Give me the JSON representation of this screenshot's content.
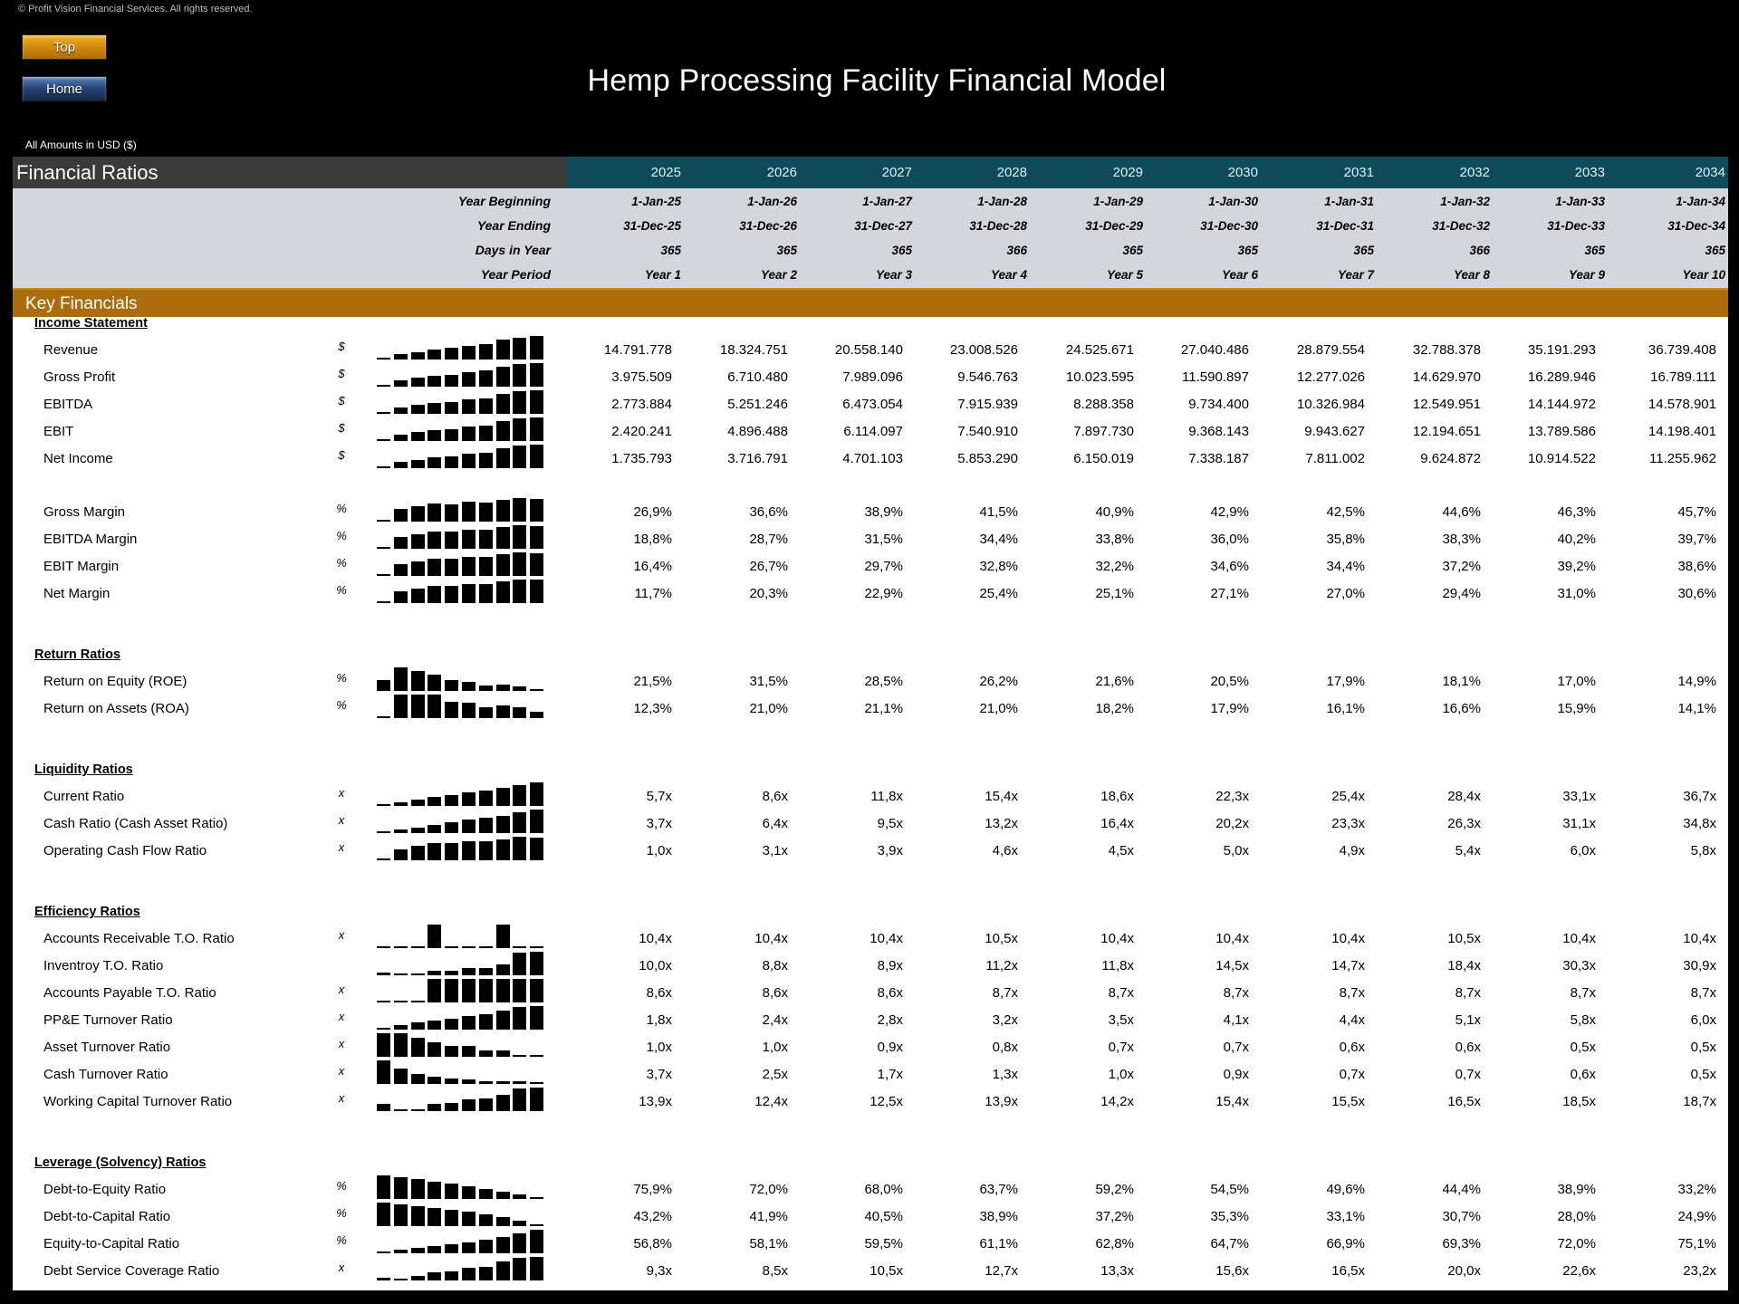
{
  "copyright": "© Profit Vision Financial Services. All rights reserved.",
  "nav": {
    "top_label": "Top",
    "home_label": "Home"
  },
  "title": "Hemp Processing Facility Financial Model",
  "currency_note": "All Amounts in  USD ($)",
  "sheet": {
    "title": "Financial Ratios",
    "years": [
      "2025",
      "2026",
      "2027",
      "2028",
      "2029",
      "2030",
      "2031",
      "2032",
      "2033",
      "2034"
    ],
    "date_rows": [
      {
        "label": "Year Beginning",
        "values": [
          "1-Jan-25",
          "1-Jan-26",
          "1-Jan-27",
          "1-Jan-28",
          "1-Jan-29",
          "1-Jan-30",
          "1-Jan-31",
          "1-Jan-32",
          "1-Jan-33",
          "1-Jan-34"
        ]
      },
      {
        "label": "Year Ending",
        "values": [
          "31-Dec-25",
          "31-Dec-26",
          "31-Dec-27",
          "31-Dec-28",
          "31-Dec-29",
          "31-Dec-30",
          "31-Dec-31",
          "31-Dec-32",
          "31-Dec-33",
          "31-Dec-34"
        ]
      },
      {
        "label": "Days in Year",
        "values": [
          "365",
          "365",
          "365",
          "366",
          "365",
          "365",
          "365",
          "366",
          "365",
          "365"
        ]
      },
      {
        "label": "Year Period",
        "values": [
          "Year 1",
          "Year 2",
          "Year 3",
          "Year 4",
          "Year 5",
          "Year 6",
          "Year 7",
          "Year 8",
          "Year 9",
          "Year 10"
        ]
      }
    ],
    "band_title": "Key Financials"
  },
  "sections": [
    {
      "title": "Income Statement",
      "rows": [
        {
          "label": "Revenue",
          "unit": "$",
          "values": [
            "14.791.778",
            "18.324.751",
            "20.558.140",
            "23.008.526",
            "24.525.671",
            "27.040.486",
            "28.879.554",
            "32.788.378",
            "35.191.293",
            "36.739.408"
          ]
        },
        {
          "label": "Gross Profit",
          "unit": "$",
          "values": [
            "3.975.509",
            "6.710.480",
            "7.989.096",
            "9.546.763",
            "10.023.595",
            "11.590.897",
            "12.277.026",
            "14.629.970",
            "16.289.946",
            "16.789.111"
          ]
        },
        {
          "label": "EBITDA",
          "unit": "$",
          "values": [
            "2.773.884",
            "5.251.246",
            "6.473.054",
            "7.915.939",
            "8.288.358",
            "9.734.400",
            "10.326.984",
            "12.549.951",
            "14.144.972",
            "14.578.901"
          ]
        },
        {
          "label": "EBIT",
          "unit": "$",
          "values": [
            "2.420.241",
            "4.896.488",
            "6.114.097",
            "7.540.910",
            "7.897.730",
            "9.368.143",
            "9.943.627",
            "12.194.651",
            "13.789.586",
            "14.198.401"
          ]
        },
        {
          "label": "Net Income",
          "unit": "$",
          "values": [
            "1.735.793",
            "3.716.791",
            "4.701.103",
            "5.853.290",
            "6.150.019",
            "7.338.187",
            "7.811.002",
            "9.624.872",
            "10.914.522",
            "11.255.962"
          ]
        },
        {
          "spacer": true
        },
        {
          "label": "Gross Margin",
          "unit": "%",
          "values": [
            "26,9%",
            "36,6%",
            "38,9%",
            "41,5%",
            "40,9%",
            "42,9%",
            "42,5%",
            "44,6%",
            "46,3%",
            "45,7%"
          ]
        },
        {
          "label": "EBITDA Margin",
          "unit": "%",
          "values": [
            "18,8%",
            "28,7%",
            "31,5%",
            "34,4%",
            "33,8%",
            "36,0%",
            "35,8%",
            "38,3%",
            "40,2%",
            "39,7%"
          ]
        },
        {
          "label": "EBIT Margin",
          "unit": "%",
          "values": [
            "16,4%",
            "26,7%",
            "29,7%",
            "32,8%",
            "32,2%",
            "34,6%",
            "34,4%",
            "37,2%",
            "39,2%",
            "38,6%"
          ]
        },
        {
          "label": "Net Margin",
          "unit": "%",
          "values": [
            "11,7%",
            "20,3%",
            "22,9%",
            "25,4%",
            "25,1%",
            "27,1%",
            "27,0%",
            "29,4%",
            "31,0%",
            "30,6%"
          ]
        }
      ]
    },
    {
      "title": "Return Ratios",
      "rows": [
        {
          "label": "Return on Equity (ROE)",
          "unit": "%",
          "values": [
            "21,5%",
            "31,5%",
            "28,5%",
            "26,2%",
            "21,6%",
            "20,5%",
            "17,9%",
            "18,1%",
            "17,0%",
            "14,9%"
          ]
        },
        {
          "label": "Return on Assets (ROA)",
          "unit": "%",
          "values": [
            "12,3%",
            "21,0%",
            "21,1%",
            "21,0%",
            "18,2%",
            "17,9%",
            "16,1%",
            "16,6%",
            "15,9%",
            "14,1%"
          ]
        }
      ]
    },
    {
      "title": "Liquidity Ratios",
      "rows": [
        {
          "label": "Current Ratio",
          "unit": "x",
          "values": [
            "5,7x",
            "8,6x",
            "11,8x",
            "15,4x",
            "18,6x",
            "22,3x",
            "25,4x",
            "28,4x",
            "33,1x",
            "36,7x"
          ]
        },
        {
          "label": "Cash Ratio (Cash Asset Ratio)",
          "unit": "x",
          "values": [
            "3,7x",
            "6,4x",
            "9,5x",
            "13,2x",
            "16,4x",
            "20,2x",
            "23,3x",
            "26,3x",
            "31,1x",
            "34,8x"
          ]
        },
        {
          "label": "Operating Cash Flow Ratio",
          "unit": "x",
          "values": [
            "1,0x",
            "3,1x",
            "3,9x",
            "4,6x",
            "4,5x",
            "5,0x",
            "4,9x",
            "5,4x",
            "6,0x",
            "5,8x"
          ]
        }
      ]
    },
    {
      "title": "Efficiency Ratios",
      "rows": [
        {
          "label": "Accounts Receivable T.O. Ratio",
          "unit": "x",
          "values": [
            "10,4x",
            "10,4x",
            "10,4x",
            "10,5x",
            "10,4x",
            "10,4x",
            "10,4x",
            "10,5x",
            "10,4x",
            "10,4x"
          ]
        },
        {
          "label": "Inventroy T.O. Ratio",
          "unit": "",
          "values": [
            "10,0x",
            "8,8x",
            "8,9x",
            "11,2x",
            "11,8x",
            "14,5x",
            "14,7x",
            "18,4x",
            "30,3x",
            "30,9x"
          ]
        },
        {
          "label": "Accounts Payable T.O. Ratio",
          "unit": "x",
          "values": [
            "8,6x",
            "8,6x",
            "8,6x",
            "8,7x",
            "8,7x",
            "8,7x",
            "8,7x",
            "8,7x",
            "8,7x",
            "8,7x"
          ]
        },
        {
          "label": "PP&E Turnover Ratio",
          "unit": "x",
          "values": [
            "1,8x",
            "2,4x",
            "2,8x",
            "3,2x",
            "3,5x",
            "4,1x",
            "4,4x",
            "5,1x",
            "5,8x",
            "6,0x"
          ]
        },
        {
          "label": "Asset Turnover Ratio",
          "unit": "x",
          "values": [
            "1,0x",
            "1,0x",
            "0,9x",
            "0,8x",
            "0,7x",
            "0,7x",
            "0,6x",
            "0,6x",
            "0,5x",
            "0,5x"
          ]
        },
        {
          "label": "Cash Turnover Ratio",
          "unit": "x",
          "values": [
            "3,7x",
            "2,5x",
            "1,7x",
            "1,3x",
            "1,0x",
            "0,9x",
            "0,7x",
            "0,7x",
            "0,6x",
            "0,5x"
          ]
        },
        {
          "label": "Working Capital Turnover Ratio",
          "unit": "x",
          "values": [
            "13,9x",
            "12,4x",
            "12,5x",
            "13,9x",
            "14,2x",
            "15,4x",
            "15,5x",
            "16,5x",
            "18,5x",
            "18,7x"
          ]
        }
      ]
    },
    {
      "title": "Leverage (Solvency) Ratios",
      "rows": [
        {
          "label": "Debt-to-Equity Ratio",
          "unit": "%",
          "values": [
            "75,9%",
            "72,0%",
            "68,0%",
            "63,7%",
            "59,2%",
            "54,5%",
            "49,6%",
            "44,4%",
            "38,9%",
            "33,2%"
          ]
        },
        {
          "label": "Debt-to-Capital Ratio",
          "unit": "%",
          "values": [
            "43,2%",
            "41,9%",
            "40,5%",
            "38,9%",
            "37,2%",
            "35,3%",
            "33,1%",
            "30,7%",
            "28,0%",
            "24,9%"
          ]
        },
        {
          "label": "Equity-to-Capital Ratio",
          "unit": "%",
          "values": [
            "56,8%",
            "58,1%",
            "59,5%",
            "61,1%",
            "62,8%",
            "64,7%",
            "66,9%",
            "69,3%",
            "72,0%",
            "75,1%"
          ]
        },
        {
          "label": "Debt Service Coverage Ratio",
          "unit": "x",
          "values": [
            "9,3x",
            "8,5x",
            "10,5x",
            "12,7x",
            "13,3x",
            "15,6x",
            "16,5x",
            "20,0x",
            "22,6x",
            "23,2x"
          ]
        }
      ]
    }
  ]
}
